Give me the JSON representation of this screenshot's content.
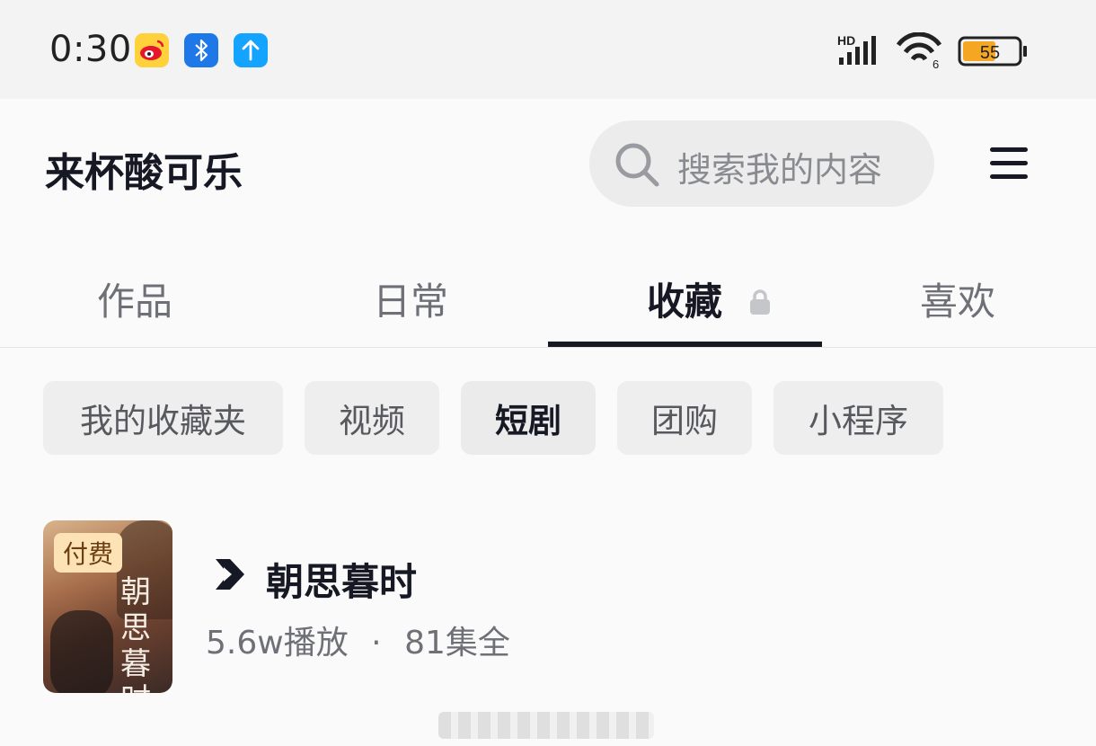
{
  "status_bar": {
    "time": "0:30",
    "network": "HD",
    "battery": "55",
    "icons": [
      "weibo-icon",
      "bluetooth-icon",
      "upload-icon",
      "signal-icon",
      "wifi-icon",
      "battery-icon"
    ]
  },
  "header": {
    "username": "来杯酸可乐",
    "search_placeholder": "搜索我的内容",
    "menu_icon": "menu-icon"
  },
  "tabs": [
    {
      "label": "作品",
      "active": false
    },
    {
      "label": "日常",
      "active": false
    },
    {
      "label": "收藏",
      "active": true,
      "locked": true
    },
    {
      "label": "喜欢",
      "active": false
    }
  ],
  "chips": [
    {
      "label": "我的收藏夹",
      "selected": false
    },
    {
      "label": "视频",
      "selected": false
    },
    {
      "label": "短剧",
      "selected": true
    },
    {
      "label": "团购",
      "selected": false
    },
    {
      "label": "小程序",
      "selected": false
    }
  ],
  "items": [
    {
      "badge": "付费",
      "poster_title": "朝思暮时",
      "title": "朝思暮时",
      "plays": "5.6w播放",
      "separator": "·",
      "episodes": "81集全"
    }
  ],
  "colors": {
    "text_primary": "#161823",
    "text_secondary": "#6f7077",
    "chip_bg": "#eeeeef",
    "battery_fill": "#f5a623"
  }
}
